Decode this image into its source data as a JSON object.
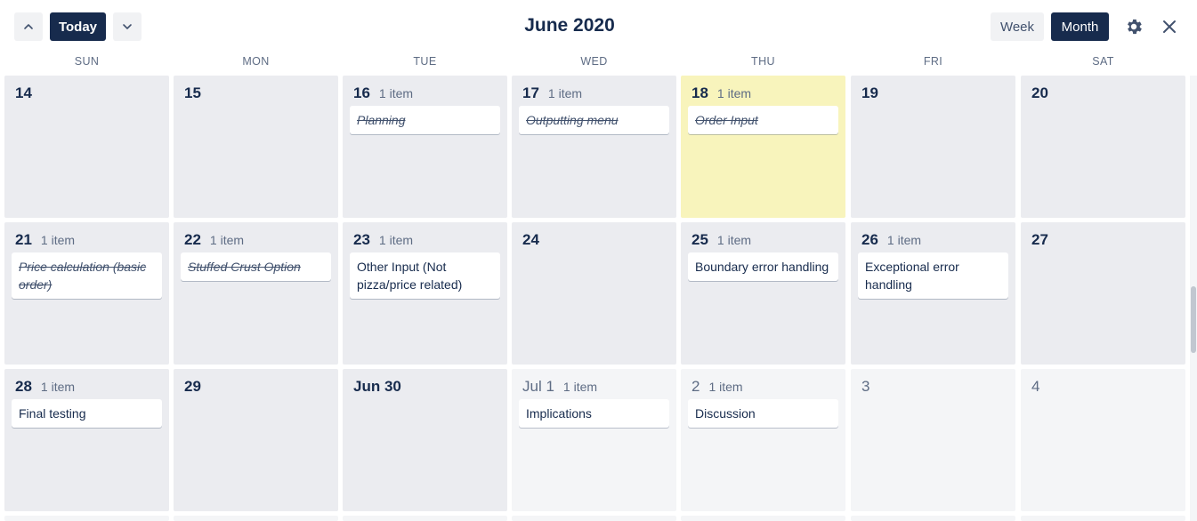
{
  "header": {
    "title": "June 2020",
    "today_label": "Today",
    "week_label": "Week",
    "month_label": "Month",
    "icons": [
      "chevron-up-icon",
      "chevron-down-icon",
      "gear-icon",
      "close-icon"
    ]
  },
  "weekdays": [
    "SUN",
    "MON",
    "TUE",
    "WED",
    "THU",
    "FRI",
    "SAT"
  ],
  "weeks": [
    [
      {
        "day": "14",
        "count": "",
        "cards": []
      },
      {
        "day": "15",
        "count": "",
        "cards": []
      },
      {
        "day": "16",
        "count": "1 item",
        "cards": [
          {
            "text": "Planning",
            "done": true
          }
        ]
      },
      {
        "day": "17",
        "count": "1 item",
        "cards": [
          {
            "text": "Outputting menu",
            "done": true
          }
        ]
      },
      {
        "day": "18",
        "count": "1 item",
        "today": true,
        "cards": [
          {
            "text": "Order Input",
            "done": true
          }
        ]
      },
      {
        "day": "19",
        "count": "",
        "cards": []
      },
      {
        "day": "20",
        "count": "",
        "cards": []
      }
    ],
    [
      {
        "day": "21",
        "count": "1 item",
        "cards": [
          {
            "text": "Price calculation (basic order)",
            "done": true
          }
        ]
      },
      {
        "day": "22",
        "count": "1 item",
        "cards": [
          {
            "text": "Stuffed Crust Option",
            "done": true
          }
        ]
      },
      {
        "day": "23",
        "count": "1 item",
        "cards": [
          {
            "text": "Other Input (Not pizza/price related)",
            "done": false
          }
        ]
      },
      {
        "day": "24",
        "count": "",
        "cards": []
      },
      {
        "day": "25",
        "count": "1 item",
        "cards": [
          {
            "text": "Boundary error handling",
            "done": false
          }
        ]
      },
      {
        "day": "26",
        "count": "1 item",
        "cards": [
          {
            "text": "Exceptional error handling",
            "done": false
          }
        ]
      },
      {
        "day": "27",
        "count": "",
        "cards": []
      }
    ],
    [
      {
        "day": "28",
        "count": "1 item",
        "cards": [
          {
            "text": "Final testing",
            "done": false
          }
        ]
      },
      {
        "day": "29",
        "count": "",
        "cards": []
      },
      {
        "day": "Jun 30",
        "count": "",
        "cards": []
      },
      {
        "day": "Jul 1",
        "count": "1 item",
        "out": true,
        "cards": [
          {
            "text": "Implications",
            "done": false
          }
        ]
      },
      {
        "day": "2",
        "count": "1 item",
        "out": true,
        "cards": [
          {
            "text": "Discussion",
            "done": false
          }
        ]
      },
      {
        "day": "3",
        "count": "",
        "out": true,
        "cards": []
      },
      {
        "day": "4",
        "count": "",
        "out": true,
        "cards": []
      }
    ]
  ],
  "colors": {
    "primary": "#172b4d",
    "cell": "#ebecf0",
    "cell_other_month": "#f4f5f7",
    "today": "#f8f4bc",
    "muted_text": "#5e6c84"
  }
}
